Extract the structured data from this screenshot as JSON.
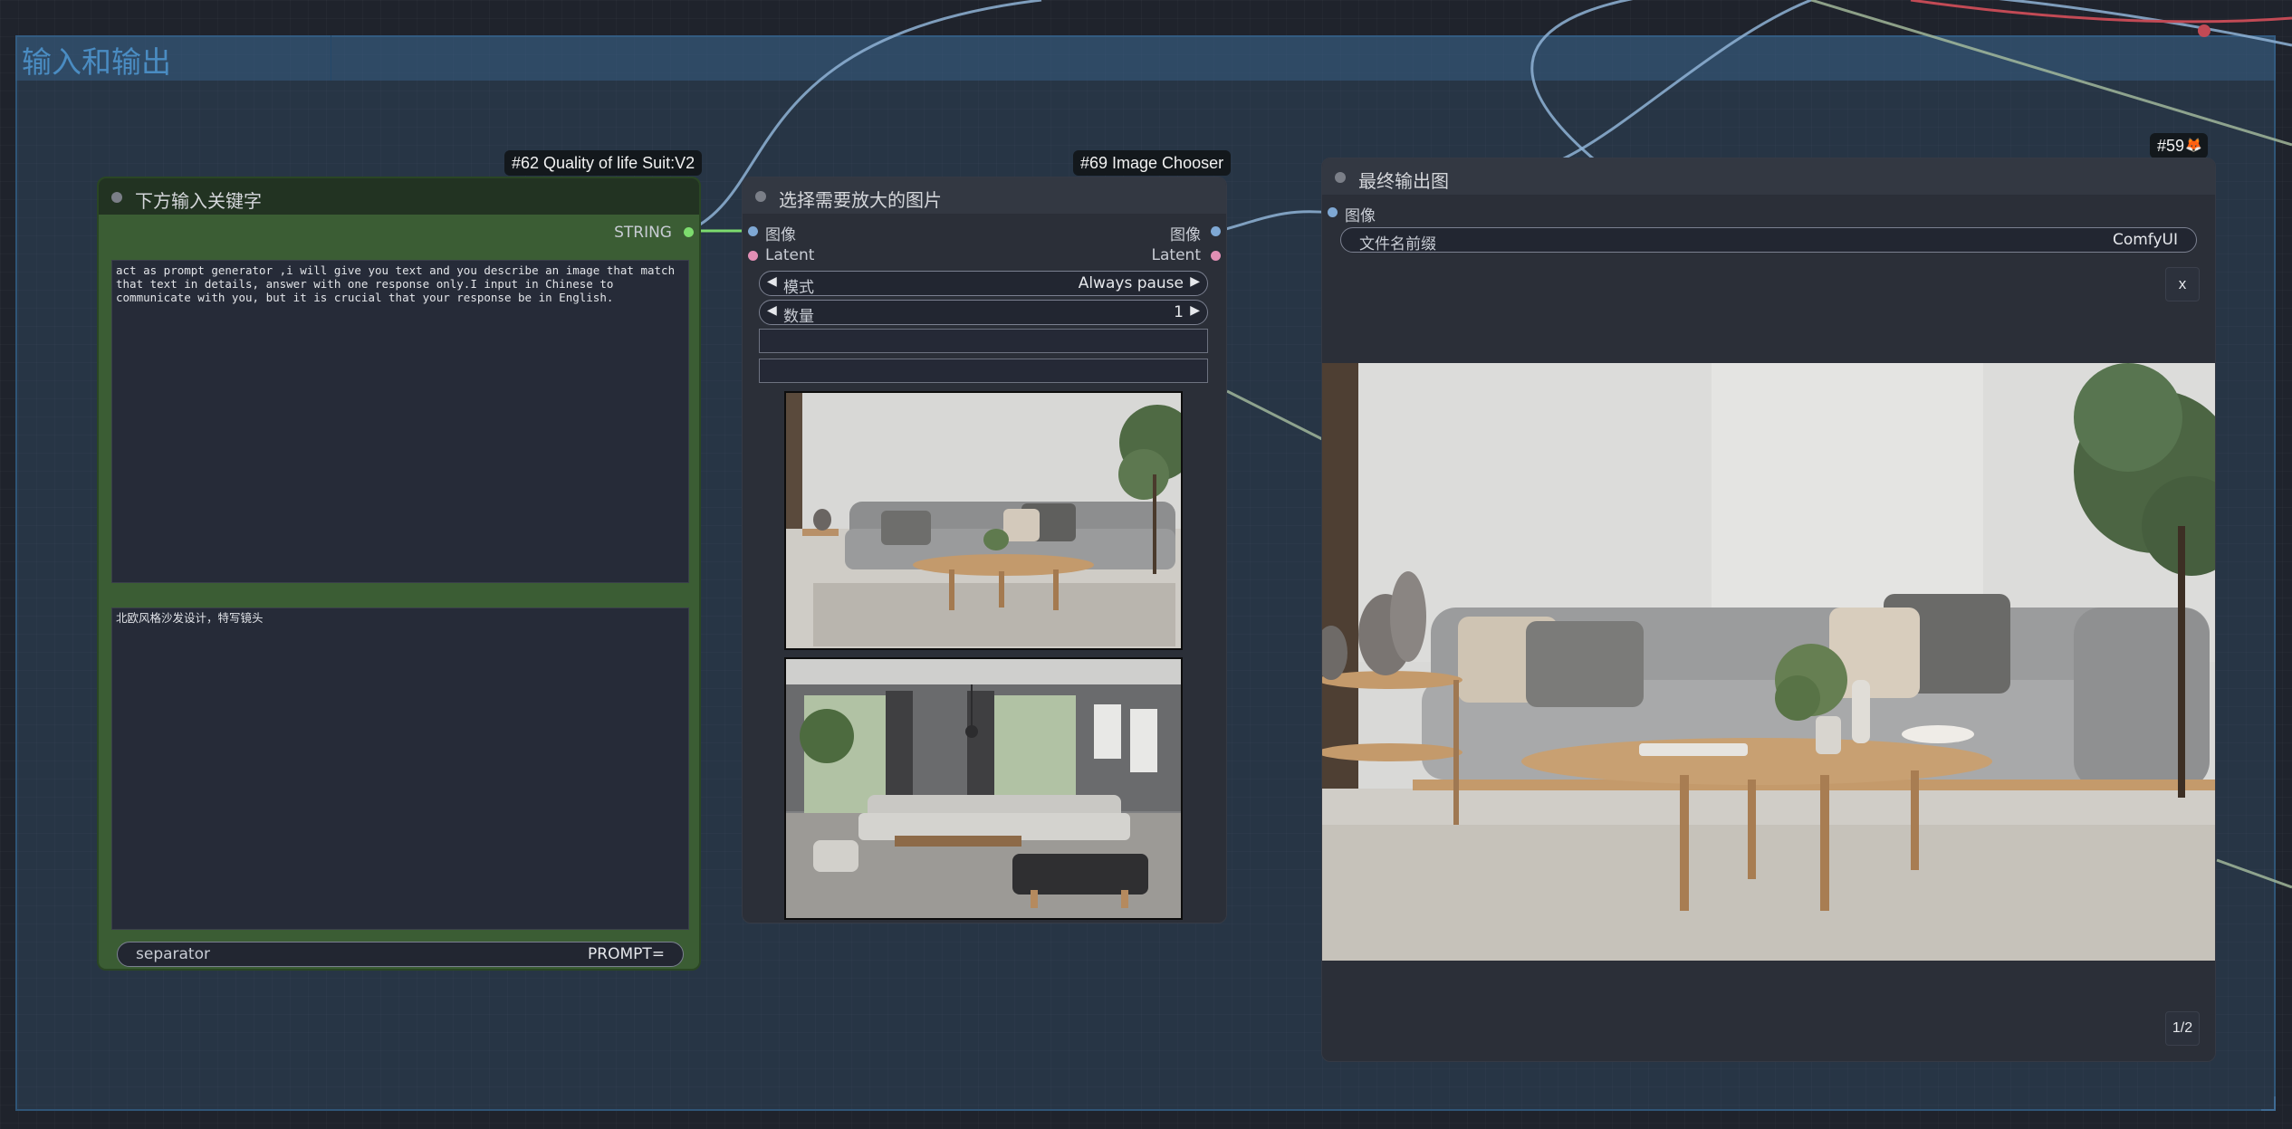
{
  "group": {
    "title": "输入和输出"
  },
  "node62": {
    "badge": "#62 Quality of life Suit:V2",
    "title": "下方输入关键字",
    "output_label": "STRING",
    "prompt_text": "act as prompt generator ,i will give you text and you describe an image that match that text in details, answer with one response only.I input in Chinese to communicate with you, but it is crucial that your response be in English.",
    "keyword_text": "北欧风格沙发设计，特写镜头",
    "separator_label": "separator",
    "separator_value": "PROMPT="
  },
  "node69": {
    "badge": "#69 Image Chooser",
    "title": "选择需要放大的图片",
    "inputs": [
      {
        "label": "图像"
      },
      {
        "label": "Latent"
      }
    ],
    "outputs": [
      {
        "label": "图像"
      },
      {
        "label": "Latent"
      }
    ],
    "mode_label": "模式",
    "mode_value": "Always pause",
    "count_label": "数量",
    "count_value": "1"
  },
  "node59": {
    "badge": "#59",
    "badge_icon": "fox-icon",
    "title": "最终输出图",
    "input_label": "图像",
    "prefix_label": "文件名前缀",
    "prefix_value": "ComfyUI",
    "close_label": "x",
    "pager": "1/2"
  },
  "colors": {
    "node62_body": "#3b5d34",
    "node62_title": "#223322",
    "node_body": "#2b2f38",
    "string_port": "#7ddc6e",
    "image_port": "#7fa8d4",
    "latent_port": "#e28fb5"
  }
}
